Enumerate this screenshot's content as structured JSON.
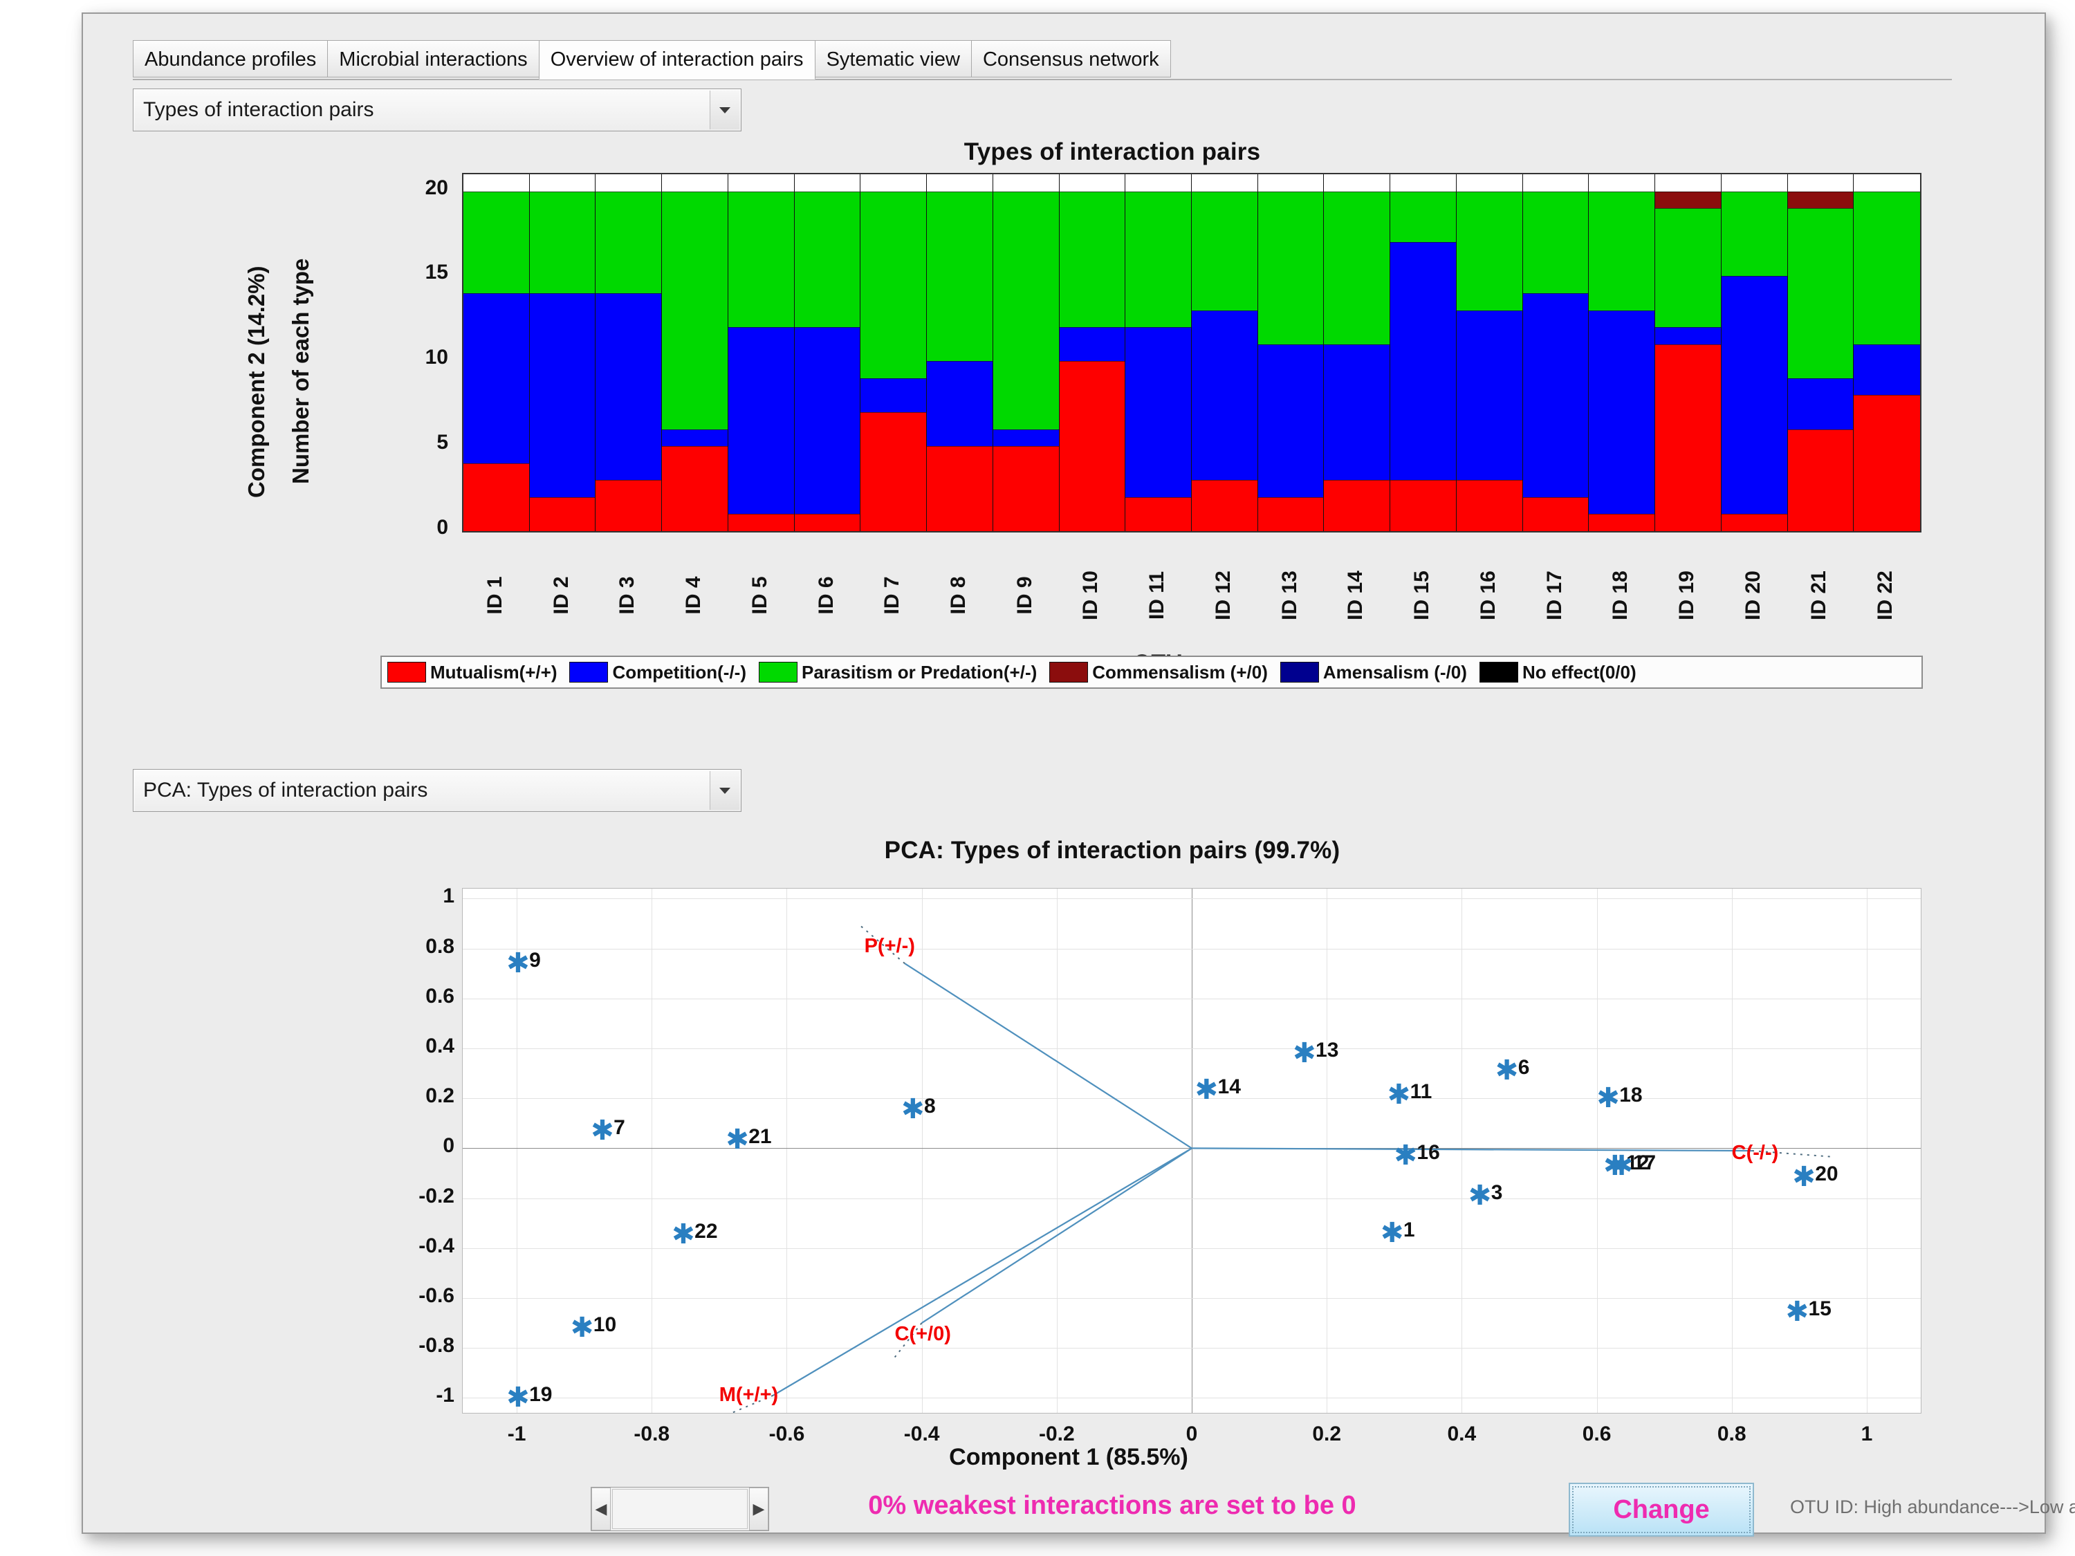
{
  "tabs": [
    {
      "label": "Abundance profiles",
      "selected": false
    },
    {
      "label": "Microbial interactions",
      "selected": false
    },
    {
      "label": "Overview of interaction pairs",
      "selected": true
    },
    {
      "label": "Sytematic view",
      "selected": false
    },
    {
      "label": "Consensus network",
      "selected": false
    }
  ],
  "top_select": {
    "value": "Types of interaction pairs"
  },
  "pca_select": {
    "value": "PCA: Types of interaction pairs"
  },
  "bottom": {
    "weak_text": "0% weakest interactions are set to be 0",
    "change_label": "Change",
    "otu_note": "OTU ID: High abundance--->Low abundance",
    "slider_left": "◀",
    "slider_right": "▶"
  },
  "chart_data": [
    {
      "type": "bar",
      "stacked": true,
      "title": "Types of interaction pairs",
      "xlabel": "OTU name",
      "ylabel": "Number of each type",
      "ylim": [
        0,
        21
      ],
      "yticks": [
        0,
        5,
        10,
        15,
        20
      ],
      "grid": false,
      "legend_position": "bottom",
      "categories": [
        "ID 1",
        "ID 2",
        "ID 3",
        "ID 4",
        "ID 5",
        "ID 6",
        "ID 7",
        "ID 8",
        "ID 9",
        "ID 10",
        "ID 11",
        "ID 12",
        "ID 13",
        "ID 14",
        "ID 15",
        "ID 16",
        "ID 17",
        "ID 18",
        "ID 19",
        "ID 20",
        "ID 21",
        "ID 22"
      ],
      "series": [
        {
          "name": "Mutualism(+/+)",
          "color": "#fe0000",
          "values": [
            4,
            2,
            3,
            5,
            1,
            1,
            7,
            5,
            5,
            10,
            2,
            3,
            2,
            3,
            3,
            3,
            2,
            1,
            11,
            1,
            6,
            8
          ]
        },
        {
          "name": "Competition(-/-)",
          "color": "#0000fd",
          "values": [
            10,
            12,
            11,
            1,
            11,
            11,
            2,
            5,
            1,
            2,
            10,
            10,
            9,
            8,
            14,
            10,
            12,
            12,
            1,
            14,
            3,
            3
          ]
        },
        {
          "name": "Parasitism or Predation(+/-)",
          "color": "#00d900",
          "values": [
            6,
            6,
            6,
            14,
            8,
            8,
            11,
            10,
            14,
            8,
            8,
            7,
            9,
            9,
            3,
            7,
            6,
            7,
            7,
            5,
            10,
            9
          ]
        },
        {
          "name": "Commensalism (+/0)",
          "color": "#8b0d0d",
          "values": [
            0,
            0,
            0,
            0,
            0,
            0,
            0,
            0,
            0,
            0,
            0,
            0,
            0,
            0,
            0,
            0,
            0,
            0,
            1,
            0,
            1,
            0
          ]
        },
        {
          "name": "Amensalism (-/0)",
          "color": "#00008f",
          "values": [
            0,
            0,
            0,
            0,
            0,
            0,
            0,
            0,
            0,
            0,
            0,
            0,
            0,
            0,
            0,
            0,
            0,
            0,
            0,
            0,
            0,
            0
          ]
        },
        {
          "name": "No effect(0/0)",
          "color": "#000000",
          "values": [
            0,
            0,
            0,
            0,
            0,
            0,
            0,
            0,
            0,
            0,
            0,
            0,
            0,
            0,
            0,
            0,
            0,
            0,
            0,
            0,
            0,
            0
          ]
        }
      ]
    },
    {
      "type": "scatter",
      "title": "PCA: Types of interaction pairs (99.7%)",
      "xlabel": "Component 1 (85.5%)",
      "ylabel": "Component 2 (14.2%)",
      "xlim": [
        -1.08,
        1.08
      ],
      "ylim": [
        -1.06,
        1.04
      ],
      "xticks": [
        -1,
        -0.8,
        -0.6,
        -0.4,
        -0.2,
        0,
        0.2,
        0.4,
        0.6,
        0.8,
        1
      ],
      "xticklabels": [
        "-1",
        "-0.8",
        "-0.6",
        "-0.4",
        "-0.2",
        "0",
        "0.2",
        "0.4",
        "0.6",
        "0.8",
        "1"
      ],
      "yticks": [
        -1,
        -0.8,
        -0.6,
        -0.4,
        -0.2,
        0,
        0.2,
        0.4,
        0.6,
        0.8,
        1
      ],
      "yticklabels": [
        "-1",
        "-0.8",
        "-0.6",
        "-0.4",
        "-0.2",
        "0",
        "0.2",
        "0.4",
        "0.6",
        "0.8",
        "1"
      ],
      "grid": true,
      "point_color": "#2a7fc1",
      "points": [
        {
          "label": "9",
          "x": -1.0,
          "y": 0.74
        },
        {
          "label": "7",
          "x": -0.875,
          "y": 0.07
        },
        {
          "label": "21",
          "x": -0.675,
          "y": 0.035
        },
        {
          "label": "8",
          "x": -0.415,
          "y": 0.155
        },
        {
          "label": "22",
          "x": -0.755,
          "y": -0.345
        },
        {
          "label": "10",
          "x": -0.905,
          "y": -0.72
        },
        {
          "label": "19",
          "x": -1.0,
          "y": -1.0
        },
        {
          "label": "14",
          "x": 0.02,
          "y": 0.235
        },
        {
          "label": "13",
          "x": 0.165,
          "y": 0.38
        },
        {
          "label": "11",
          "x": 0.305,
          "y": 0.215
        },
        {
          "label": "6",
          "x": 0.465,
          "y": 0.31
        },
        {
          "label": "18",
          "x": 0.615,
          "y": 0.2
        },
        {
          "label": "16",
          "x": 0.315,
          "y": -0.03
        },
        {
          "label": "12",
          "x": 0.625,
          "y": -0.07
        },
        {
          "label": "17",
          "x": 0.635,
          "y": -0.07
        },
        {
          "label": "20",
          "x": 0.905,
          "y": -0.115
        },
        {
          "label": "3",
          "x": 0.425,
          "y": -0.19
        },
        {
          "label": "1",
          "x": 0.295,
          "y": -0.34
        },
        {
          "label": "15",
          "x": 0.895,
          "y": -0.655
        }
      ],
      "vectors": [
        {
          "label": "P(+/-)",
          "color": "#f30000",
          "x": -0.44,
          "y": 0.8,
          "tip_x": -0.425,
          "tip_y": 0.74
        },
        {
          "label": "C(-/-)",
          "color": "#f30000",
          "x": 0.845,
          "y": -0.03,
          "tip_x": 0.83,
          "tip_y": -0.01
        },
        {
          "label": "C(+/0)",
          "color": "#f30000",
          "x": -0.395,
          "y": -0.755,
          "tip_x": -0.4,
          "tip_y": -0.7
        },
        {
          "label": "M(+/+)",
          "color": "#f30000",
          "x": -0.655,
          "y": -1.0,
          "tip_x": -0.62,
          "tip_y": -0.99
        }
      ]
    }
  ]
}
